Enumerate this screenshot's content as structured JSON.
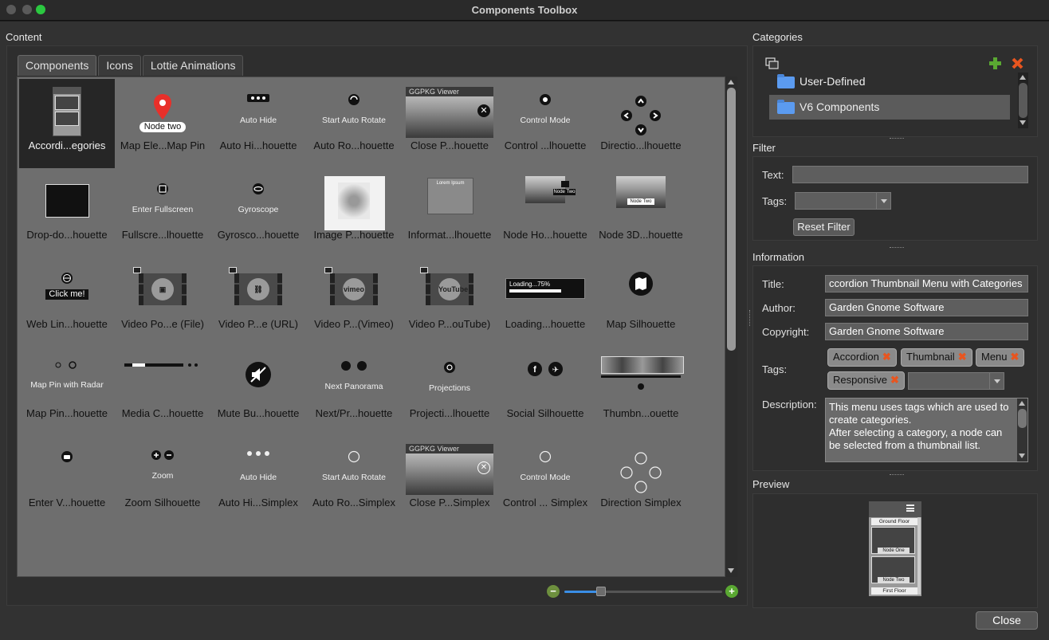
{
  "window": {
    "title": "Components Toolbox"
  },
  "content": {
    "label": "Content",
    "tabs": [
      {
        "label": "Components",
        "active": true
      },
      {
        "label": "Icons",
        "active": false
      },
      {
        "label": "Lottie Animations",
        "active": false
      }
    ],
    "tiles": [
      {
        "label": "Accordi...egories",
        "selected": true,
        "preview": "accordion-thumbnail"
      },
      {
        "label": "Map Ele...Map Pin",
        "preview": "map-pin",
        "caption": "Node two"
      },
      {
        "label": "Auto Hi...houette",
        "preview": "auto-hide",
        "caption": "Auto Hide"
      },
      {
        "label": "Auto Ro...houette",
        "preview": "auto-rotate",
        "caption": "Start Auto Rotate"
      },
      {
        "label": "Close P...houette",
        "preview": "ggpkg-viewer",
        "caption": "GGPKG Viewer"
      },
      {
        "label": "Control ...lhouette",
        "preview": "control-mode",
        "caption": "Control Mode"
      },
      {
        "label": "Directio...lhouette",
        "preview": "direction",
        "caption": ""
      },
      {
        "label": "Drop-do...houette",
        "preview": "dropdown",
        "caption": ""
      },
      {
        "label": "Fullscre...lhouette",
        "preview": "fullscreen",
        "caption": "Enter Fullscreen"
      },
      {
        "label": "Gyrosco...houette",
        "preview": "gyroscope",
        "caption": "Gyroscope"
      },
      {
        "label": "Image P...houette",
        "preview": "image-popup",
        "caption": ""
      },
      {
        "label": "Informat...lhouette",
        "preview": "info-popup",
        "caption": "Lorem Ipsum"
      },
      {
        "label": "Node Ho...houette",
        "preview": "node-hotspot",
        "caption": "Node Two"
      },
      {
        "label": "Node 3D...houette",
        "preview": "node-3d",
        "caption": "Node Two"
      },
      {
        "label": "Web Lin...houette",
        "preview": "web-link",
        "caption": "Click me!"
      },
      {
        "label": "Video Po...e (File)",
        "preview": "video-file",
        "caption": ""
      },
      {
        "label": "Video P...e (URL)",
        "preview": "video-url",
        "caption": ""
      },
      {
        "label": "Video P...(Vimeo)",
        "preview": "video-vimeo",
        "caption": "vimeo"
      },
      {
        "label": "Video P...ouTube)",
        "preview": "video-youtube",
        "caption": "YouTube"
      },
      {
        "label": "Loading...houette",
        "preview": "loading",
        "caption": "Loading...75%"
      },
      {
        "label": "Map Silhouette",
        "preview": "map",
        "caption": ""
      },
      {
        "label": "Map Pin...houette",
        "preview": "map-pin-radar",
        "caption": "Map Pin with Radar"
      },
      {
        "label": "Media C...houette",
        "preview": "media-controller",
        "caption": ""
      },
      {
        "label": "Mute Bu...houette",
        "preview": "mute",
        "caption": ""
      },
      {
        "label": "Next/Pr...houette",
        "preview": "next-panorama",
        "caption": "Next Panorama"
      },
      {
        "label": "Projecti...lhouette",
        "preview": "projections",
        "caption": "Projections"
      },
      {
        "label": "Social Silhouette",
        "preview": "social",
        "caption": ""
      },
      {
        "label": "Thumbn...ouette",
        "preview": "thumbnail",
        "caption": ""
      },
      {
        "label": "Enter V...houette",
        "preview": "enter-vr",
        "caption": ""
      },
      {
        "label": "Zoom Silhouette",
        "preview": "zoom",
        "caption": "Zoom"
      },
      {
        "label": "Auto Hi...Simplex",
        "preview": "auto-hide-simplex",
        "caption": "Auto Hide"
      },
      {
        "label": "Auto Ro...Simplex",
        "preview": "auto-rotate-simplex",
        "caption": "Start Auto Rotate"
      },
      {
        "label": "Close P...Simplex",
        "preview": "ggpkg-viewer-simplex",
        "caption": "GGPKG Viewer"
      },
      {
        "label": "Control ... Simplex",
        "preview": "control-mode-simplex",
        "caption": "Control Mode"
      },
      {
        "label": "Direction Simplex",
        "preview": "direction-simplex",
        "caption": ""
      }
    ],
    "zoom_level": 0.23
  },
  "categories": {
    "label": "Categories",
    "items": [
      {
        "label": "User-Defined",
        "selected": false
      },
      {
        "label": "V6 Components",
        "selected": true
      }
    ]
  },
  "filter": {
    "label": "Filter",
    "text_label": "Text:",
    "text_value": "",
    "tags_label": "Tags:",
    "reset_label": "Reset Filter"
  },
  "information": {
    "label": "Information",
    "title_label": "Title:",
    "title_value": "ccordion Thumbnail Menu with Categories",
    "author_label": "Author:",
    "author_value": "Garden Gnome Software",
    "copyright_label": "Copyright:",
    "copyright_value": "Garden Gnome Software",
    "tags_label": "Tags:",
    "tags": [
      "Accordion",
      "Thumbnail",
      "Menu",
      "Responsive"
    ],
    "description_label": "Description:",
    "description": "This menu uses tags which are used to create categories.\nAfter selecting a category, a node can be selected from a thumbnail list."
  },
  "preview": {
    "label": "Preview",
    "ground_floor": "Ground Floor",
    "node_one": "Node One",
    "node_two": "Node Two",
    "first_floor": "First Floor"
  },
  "footer": {
    "close_label": "Close"
  },
  "colors": {
    "accent_blue": "#3a8ee6",
    "add_green": "#5aa832",
    "remove_orange": "#e8551f",
    "folder_blue": "#5b9bf0"
  }
}
